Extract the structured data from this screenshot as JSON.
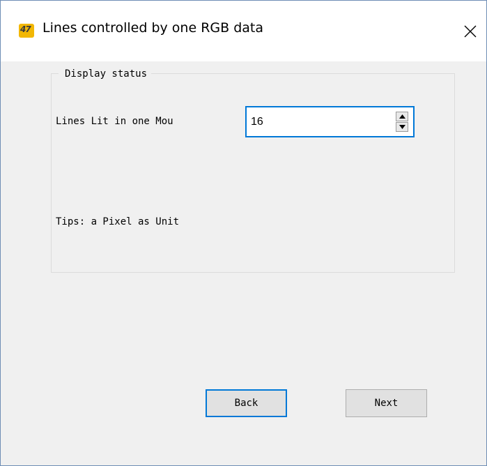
{
  "window": {
    "title": "Lines controlled by one RGB data",
    "app_icon_text": "47",
    "app_icon_color": "#f2b705",
    "close_icon": "close-icon"
  },
  "group": {
    "legend": "Display status",
    "lines_label": "Lines Lit in one Mou",
    "lines_value": "16",
    "tips": "Tips: a Pixel as Unit"
  },
  "buttons": {
    "back": "Back",
    "next": "Next"
  },
  "colors": {
    "focus_border": "#0078d7",
    "dialog_background": "#f0f0f0"
  }
}
